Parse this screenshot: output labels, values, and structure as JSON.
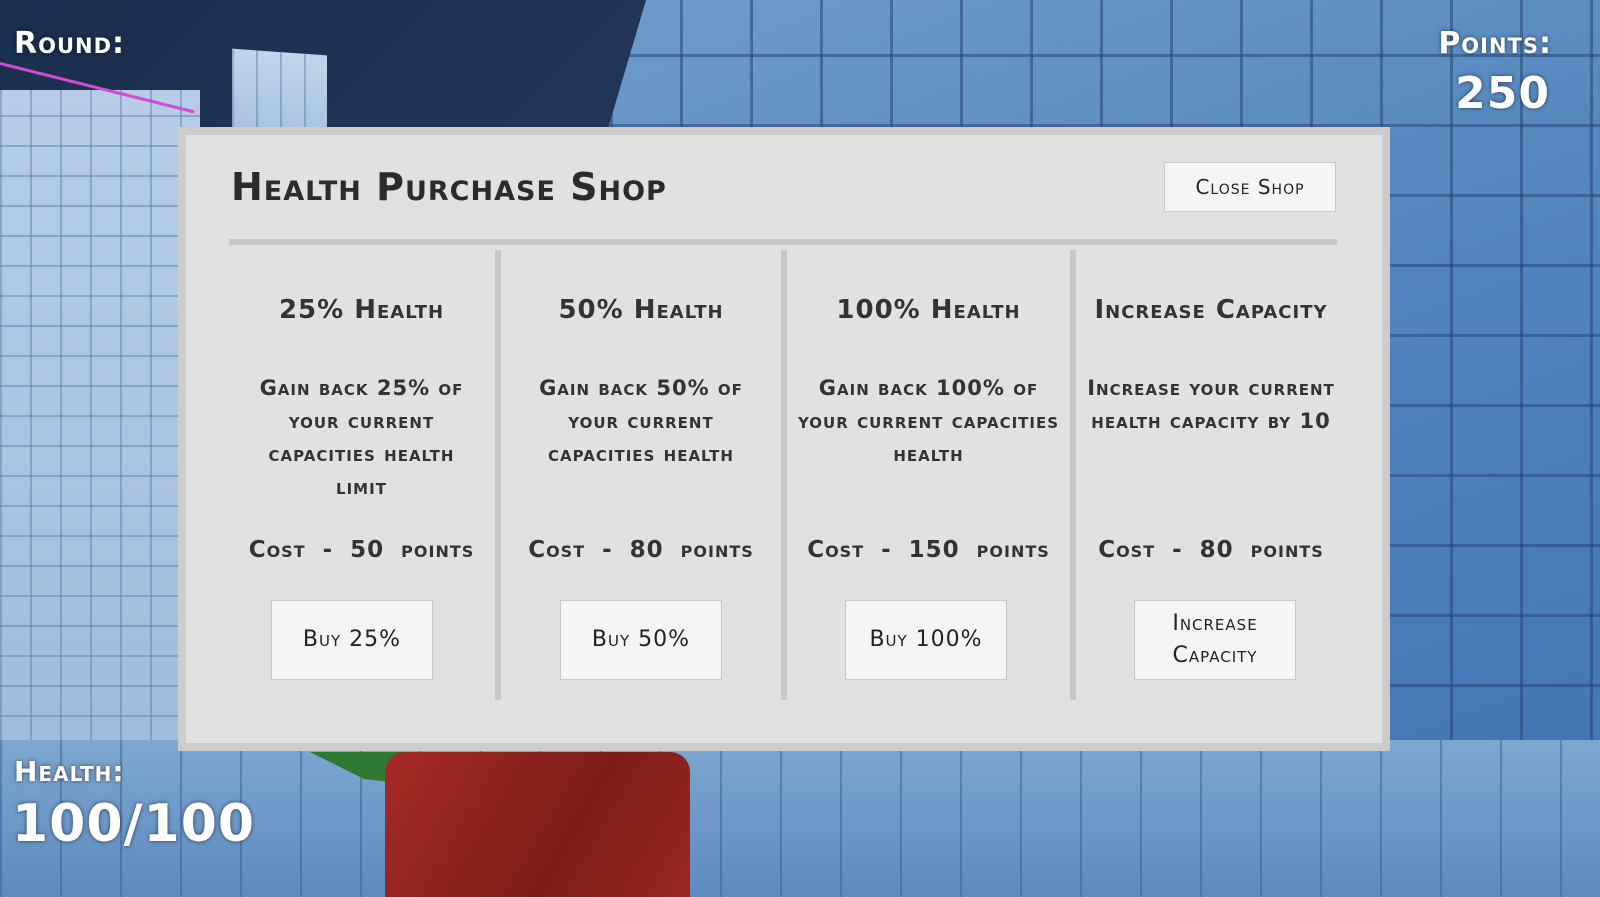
{
  "hud": {
    "round_label": "Round:",
    "points_label": "Points:",
    "points_value": "250",
    "health_label": "Health:",
    "health_value": "100/100"
  },
  "shop": {
    "title": "Health Purchase Shop",
    "close_label": "Close Shop",
    "items": [
      {
        "title": "25% Health",
        "description": "Gain back 25% of your current capacities health limit",
        "cost": "Cost - 50 points",
        "button": "Buy 25%"
      },
      {
        "title": "50% Health",
        "description": "Gain back 50% of your current capacities health",
        "cost": "Cost - 80 points",
        "button": "Buy 50%"
      },
      {
        "title": "100% Health",
        "description": "Gain back 100% of your current capacities health",
        "cost": "Cost - 150 points",
        "button": "Buy 100%"
      },
      {
        "title": "Increase Capacity",
        "description": "Increase your current health capacity by 10",
        "cost": "Cost - 80 points",
        "button": "Increase Capacity"
      }
    ]
  }
}
